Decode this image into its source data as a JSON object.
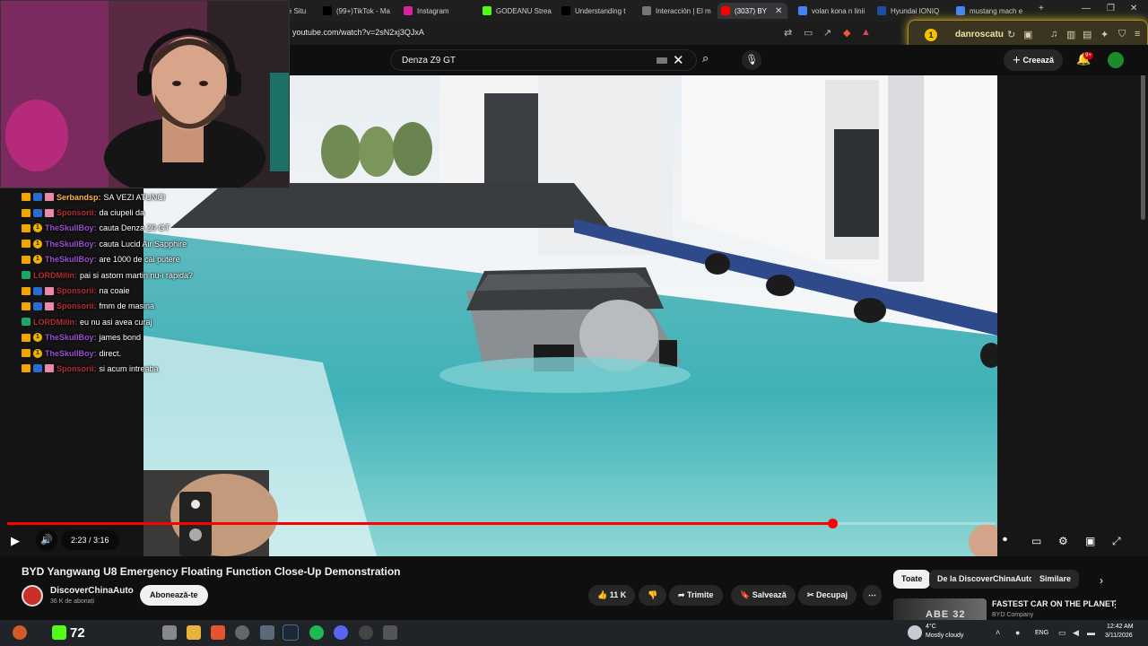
{
  "browser": {
    "tabs": [
      {
        "label": "le Situ",
        "color": "#555555"
      },
      {
        "label": "(99+)TikTok - Ma",
        "color": "#000000"
      },
      {
        "label": "Instagram",
        "color": "#d6249f"
      },
      {
        "label": "GODEANU Strea",
        "color": "#53fc18"
      },
      {
        "label": "Understanding t",
        "color": "#000000"
      },
      {
        "label": "Interacción | El m",
        "color": "#777777"
      },
      {
        "label": "(3037) BY",
        "color": "#ff0000"
      },
      {
        "label": "volan kona n linii",
        "color": "#4285f4"
      },
      {
        "label": "Hyundai IONIQ",
        "color": "#1b4fa0"
      },
      {
        "label": "mustang mach e",
        "color": "#4285f4"
      }
    ],
    "url": "youtube.com/watch?v=2sN2xj3QJxA"
  },
  "extension": {
    "username": "danroscatu",
    "badge": "1"
  },
  "youtube": {
    "search_value": "Denza Z9 GT",
    "create_label": "Creează",
    "notif_badge": "9+"
  },
  "player": {
    "time": "2:23 / 3:16",
    "progress": 0.835
  },
  "chat": [
    {
      "badges": [
        "crown",
        "mod",
        "gift"
      ],
      "user": "Serbandsp:",
      "color": "#ffb347",
      "text": "SA VEZI ATUNCI"
    },
    {
      "badges": [
        "crown",
        "mod",
        "gift"
      ],
      "user": "Sponsorii:",
      "color": "#b32f37",
      "text": "da ciupeli da"
    },
    {
      "badges": [
        "crown",
        "one"
      ],
      "user": "TheSkullBoy:",
      "color": "#9b4fd1",
      "text": "cauta Denza Z9 GT"
    },
    {
      "badges": [
        "crown",
        "one"
      ],
      "user": "TheSkullBoy:",
      "color": "#9b4fd1",
      "text": "cauta Lucid Air Sapphire"
    },
    {
      "badges": [
        "crown",
        "one"
      ],
      "user": "TheSkullBoy:",
      "color": "#9b4fd1",
      "text": "are 1000 de cai putere"
    },
    {
      "badges": [
        "sword"
      ],
      "user": "LORDMilin:",
      "color": "#b32f37",
      "text": "pai si astorn martin nu-i rapida?"
    },
    {
      "badges": [
        "crown",
        "mod",
        "gift"
      ],
      "user": "Sponsorii:",
      "color": "#b32f37",
      "text": "na coaie"
    },
    {
      "badges": [
        "crown",
        "mod",
        "gift"
      ],
      "user": "Sponsorii:",
      "color": "#b32f37",
      "text": "fmm de masina"
    },
    {
      "badges": [
        "sword"
      ],
      "user": "LORDMilin:",
      "color": "#b32f37",
      "text": "eu nu asi avea curaj"
    },
    {
      "badges": [
        "crown",
        "one"
      ],
      "user": "TheSkullBoy:",
      "color": "#9b4fd1",
      "text": "james bond"
    },
    {
      "badges": [
        "crown",
        "one"
      ],
      "user": "TheSkullBoy:",
      "color": "#9b4fd1",
      "text": "direct."
    },
    {
      "badges": [
        "crown",
        "mod",
        "gift"
      ],
      "user": "Sponsorii:",
      "color": "#b32f37",
      "text": "si acum intreaba"
    }
  ],
  "video_info": {
    "title": "BYD Yangwang U8 Emergency Floating Function Close-Up Demonstration",
    "channel": "DiscoverChinaAuto",
    "subscribers": "36 K de abonați",
    "subscribe_label": "Abonează-te",
    "likes": "11 K",
    "share_label": "Trimite",
    "save_label": "Salvează",
    "clip_label": "Decupaj"
  },
  "chips": [
    "Toate",
    "De la DiscoverChinaAuto",
    "Similare"
  ],
  "recommended": {
    "title": "FASTEST CAR ON THE PLANET",
    "channel": "BYD Company",
    "thumb_text": "ABE 32"
  },
  "taskbar": {
    "kick_count": "72",
    "weather_temp": "4°C",
    "weather_desc": "Mostly cloudy",
    "lang": "ENG",
    "clock_time": "12:42 AM",
    "clock_date": "3/11/2026"
  }
}
